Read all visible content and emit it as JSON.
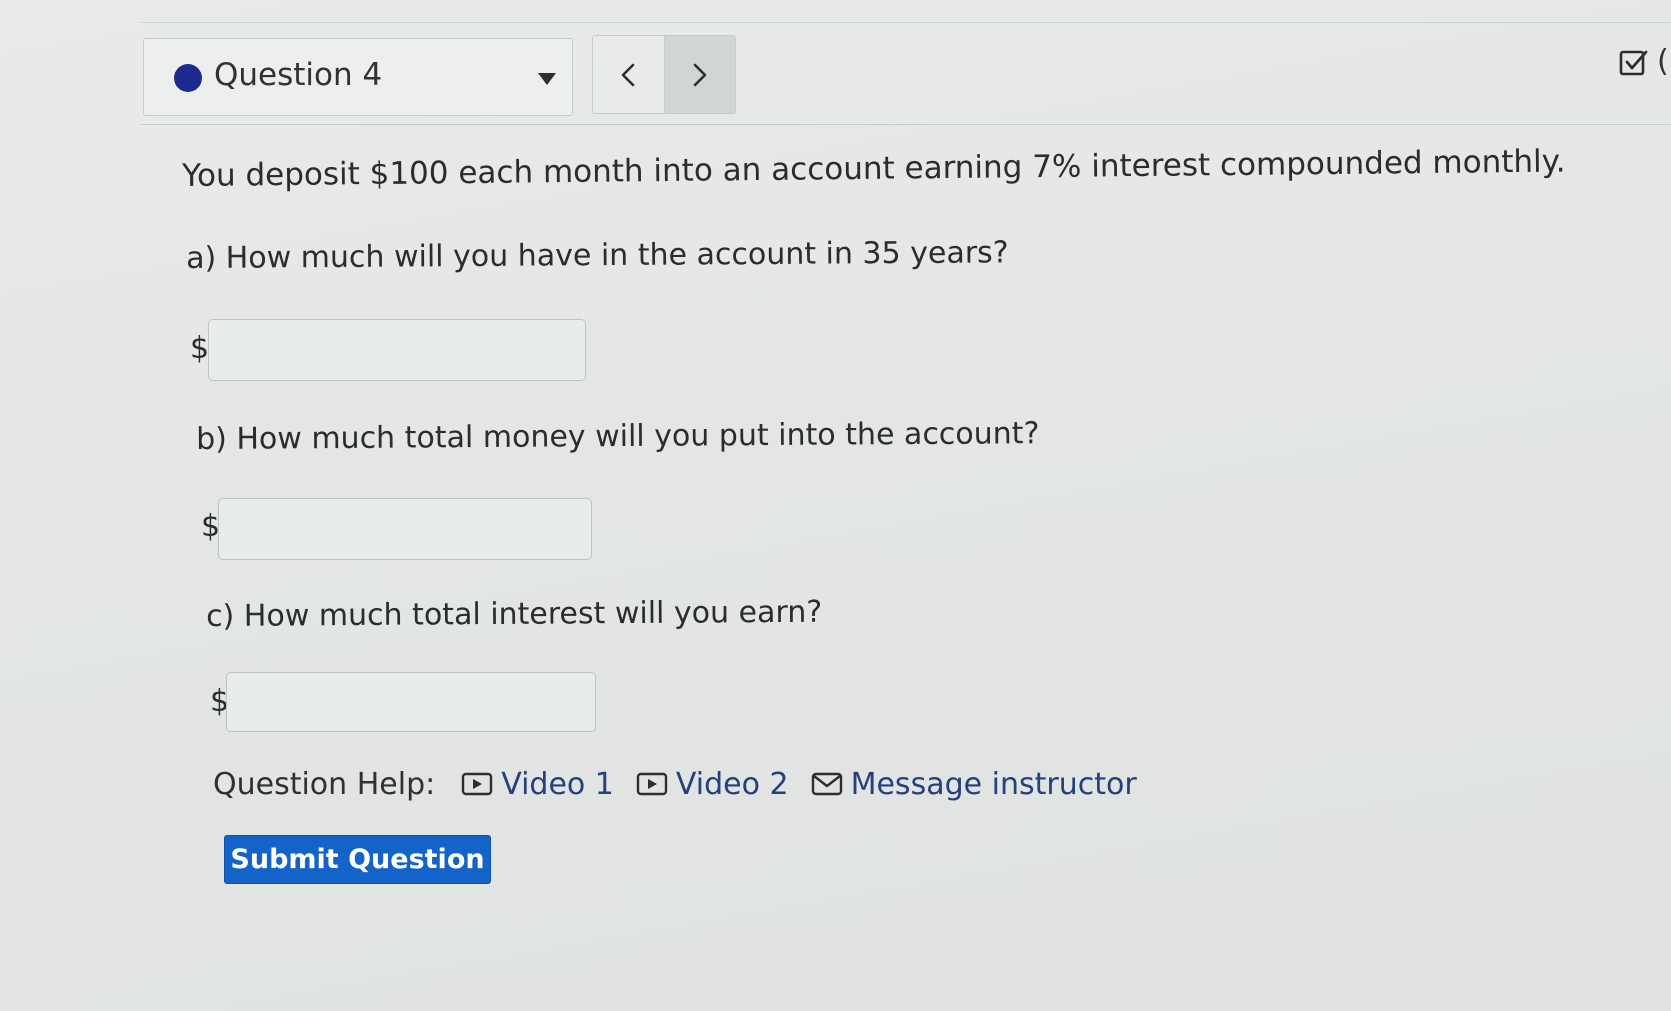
{
  "header": {
    "question_label": "Question 4",
    "prev_label": "‹",
    "next_label": "›",
    "status_color": "#1d2a8f"
  },
  "problem": {
    "statement": "You deposit $100 each month into an account earning 7% interest compounded monthly."
  },
  "parts": [
    {
      "prompt": "a) How much will you have in the account in 35 years?",
      "currency": "$",
      "value": ""
    },
    {
      "prompt": "b) How much total money will you put into the account?",
      "currency": "$",
      "value": ""
    },
    {
      "prompt": "c) How much total interest will you earn?",
      "currency": "$",
      "value": ""
    }
  ],
  "help": {
    "label": "Question Help:",
    "links": [
      {
        "label": "Video 1",
        "icon": "video-icon"
      },
      {
        "label": "Video 2",
        "icon": "video-icon"
      },
      {
        "label": "Message instructor",
        "icon": "mail-icon"
      }
    ]
  },
  "actions": {
    "submit_label": "Submit Question",
    "submit_color": "#1463c8"
  },
  "corner": {
    "partial_text": "("
  }
}
